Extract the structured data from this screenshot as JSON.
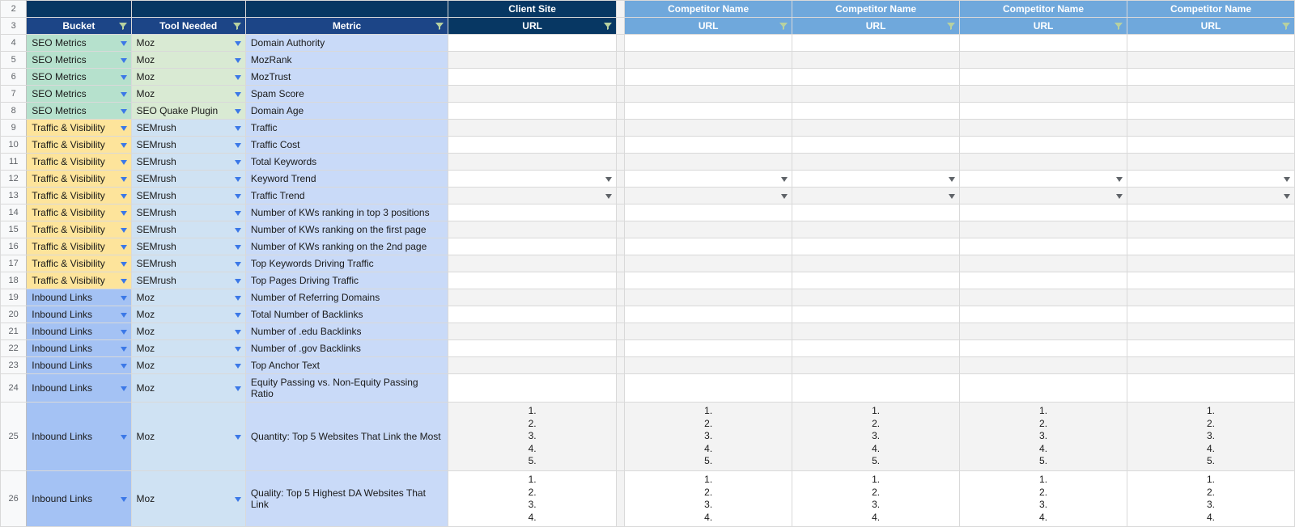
{
  "header_row2": {
    "client_site": "Client Site",
    "competitor": "Competitor Name"
  },
  "header_row3": {
    "bucket": "Bucket",
    "tool": "Tool Needed",
    "metric": "Metric",
    "url": "URL"
  },
  "row_numbers": [
    "2",
    "3",
    "4",
    "5",
    "6",
    "7",
    "8",
    "9",
    "10",
    "11",
    "12",
    "13",
    "14",
    "15",
    "16",
    "17",
    "18",
    "19",
    "20",
    "21",
    "22",
    "23",
    "24",
    "25",
    "26"
  ],
  "num_list": "1.\n2.\n3.\n4.\n5.",
  "num_list4": "1.\n2.\n3.\n4.",
  "rows": [
    {
      "bucket": "SEO Metrics",
      "bclass": "seo",
      "tool": "Moz",
      "metric": "Domain Authority",
      "dd": false
    },
    {
      "bucket": "SEO Metrics",
      "bclass": "seo",
      "tool": "Moz",
      "metric": "MozRank",
      "dd": false
    },
    {
      "bucket": "SEO Metrics",
      "bclass": "seo",
      "tool": "Moz",
      "metric": "MozTrust",
      "dd": false
    },
    {
      "bucket": "SEO Metrics",
      "bclass": "seo",
      "tool": "Moz",
      "metric": "Spam Score",
      "dd": false
    },
    {
      "bucket": "SEO Metrics",
      "bclass": "seo",
      "tool": "SEO Quake Plugin",
      "metric": "Domain Age",
      "dd": false
    },
    {
      "bucket": "Traffic & Visibility",
      "bclass": "tv",
      "tool": "SEMrush",
      "metric": "Traffic",
      "dd": false
    },
    {
      "bucket": "Traffic & Visibility",
      "bclass": "tv",
      "tool": "SEMrush",
      "metric": "Traffic Cost",
      "dd": false
    },
    {
      "bucket": "Traffic & Visibility",
      "bclass": "tv",
      "tool": "SEMrush",
      "metric": "Total Keywords",
      "dd": false
    },
    {
      "bucket": "Traffic & Visibility",
      "bclass": "tv",
      "tool": "SEMrush",
      "metric": "Keyword Trend",
      "dd": true
    },
    {
      "bucket": "Traffic & Visibility",
      "bclass": "tv",
      "tool": "SEMrush",
      "metric": "Traffic Trend",
      "dd": true
    },
    {
      "bucket": "Traffic & Visibility",
      "bclass": "tv",
      "tool": "SEMrush",
      "metric": "Number of KWs ranking in top 3 positions",
      "dd": false
    },
    {
      "bucket": "Traffic & Visibility",
      "bclass": "tv",
      "tool": "SEMrush",
      "metric": "Number of KWs ranking on the first page",
      "dd": false
    },
    {
      "bucket": "Traffic & Visibility",
      "bclass": "tv",
      "tool": "SEMrush",
      "metric": "Number of KWs ranking on the 2nd page",
      "dd": false
    },
    {
      "bucket": "Traffic & Visibility",
      "bclass": "tv",
      "tool": "SEMrush",
      "metric": "Top Keywords Driving Traffic",
      "dd": false
    },
    {
      "bucket": "Traffic & Visibility",
      "bclass": "tv",
      "tool": "SEMrush",
      "metric": "Top Pages Driving Traffic",
      "dd": false
    },
    {
      "bucket": "Inbound Links",
      "bclass": "il",
      "tool": "Moz",
      "metric": "Number of Referring Domains",
      "dd": false
    },
    {
      "bucket": "Inbound Links",
      "bclass": "il",
      "tool": "Moz",
      "metric": "Total Number of Backlinks",
      "dd": false
    },
    {
      "bucket": "Inbound Links",
      "bclass": "il",
      "tool": "Moz",
      "metric": "Number of .edu Backlinks",
      "dd": false
    },
    {
      "bucket": "Inbound Links",
      "bclass": "il",
      "tool": "Moz",
      "metric": "Number of .gov Backlinks",
      "dd": false
    },
    {
      "bucket": "Inbound Links",
      "bclass": "il",
      "tool": "Moz",
      "metric": "Top Anchor Text",
      "dd": false
    },
    {
      "bucket": "Inbound Links",
      "bclass": "il",
      "tool": "Moz",
      "metric": "Equity Passing vs. Non-Equity Passing Ratio",
      "dd": false
    },
    {
      "bucket": "Inbound Links",
      "bclass": "il",
      "tool": "Moz",
      "metric": "Quantity: Top 5 Websites That Link the Most",
      "dd": false,
      "list": 5
    },
    {
      "bucket": "Inbound Links",
      "bclass": "il",
      "tool": "Moz",
      "metric": "Quality: Top 5 Highest DA Websites That Link",
      "dd": false,
      "list": 4
    }
  ]
}
